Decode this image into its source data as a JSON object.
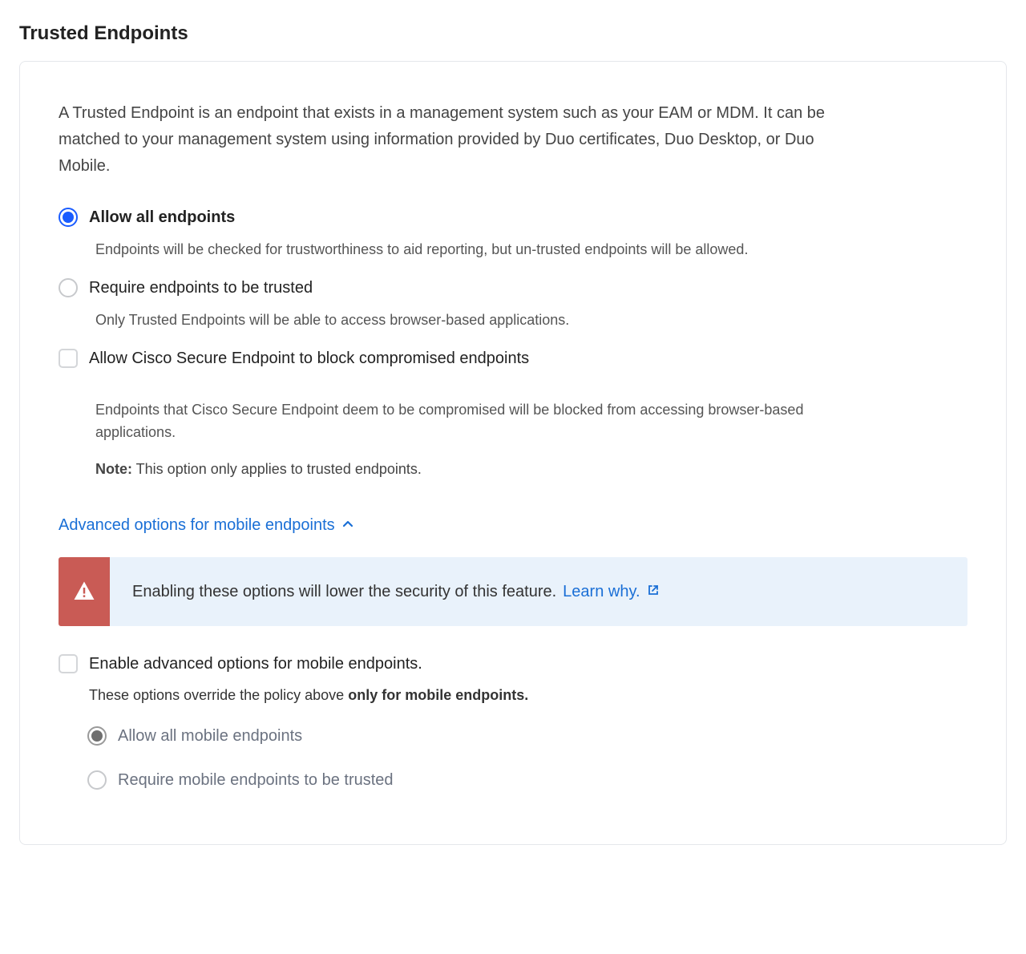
{
  "title": "Trusted Endpoints",
  "intro": "A Trusted Endpoint is an endpoint that exists in a management system such as your EAM or MDM. It can be matched to your management system using information provided by Duo certificates, Duo Desktop, or Duo Mobile.",
  "options": {
    "allow_all": {
      "label": "Allow all endpoints",
      "desc": "Endpoints will be checked for trustworthiness to aid reporting, but un-trusted endpoints will be allowed.",
      "selected": true
    },
    "require_trusted": {
      "label": "Require endpoints to be trusted",
      "desc": "Only Trusted Endpoints will be able to access browser-based applications.",
      "selected": false
    },
    "allow_cisco_block": {
      "label": "Allow Cisco Secure Endpoint to block compromised endpoints",
      "desc": "Endpoints that Cisco Secure Endpoint deem to be compromised will be blocked from accessing browser-based applications.",
      "note_label": "Note:",
      "note_text": " This option only applies to trusted endpoints.",
      "checked": false
    }
  },
  "advanced": {
    "toggle_label": "Advanced options for mobile endpoints",
    "alert_text": "Enabling these options will lower the security of this feature.",
    "alert_link": "Learn why.",
    "enable_checkbox": {
      "label": "Enable advanced options for mobile endpoints.",
      "desc_prefix": "These options override the policy above ",
      "desc_bold": "only for mobile endpoints.",
      "checked": false
    },
    "mobile_options": {
      "allow_all": {
        "label": "Allow all mobile endpoints",
        "selected": true
      },
      "require_trusted": {
        "label": "Require mobile endpoints to be trusted",
        "selected": false
      }
    }
  }
}
